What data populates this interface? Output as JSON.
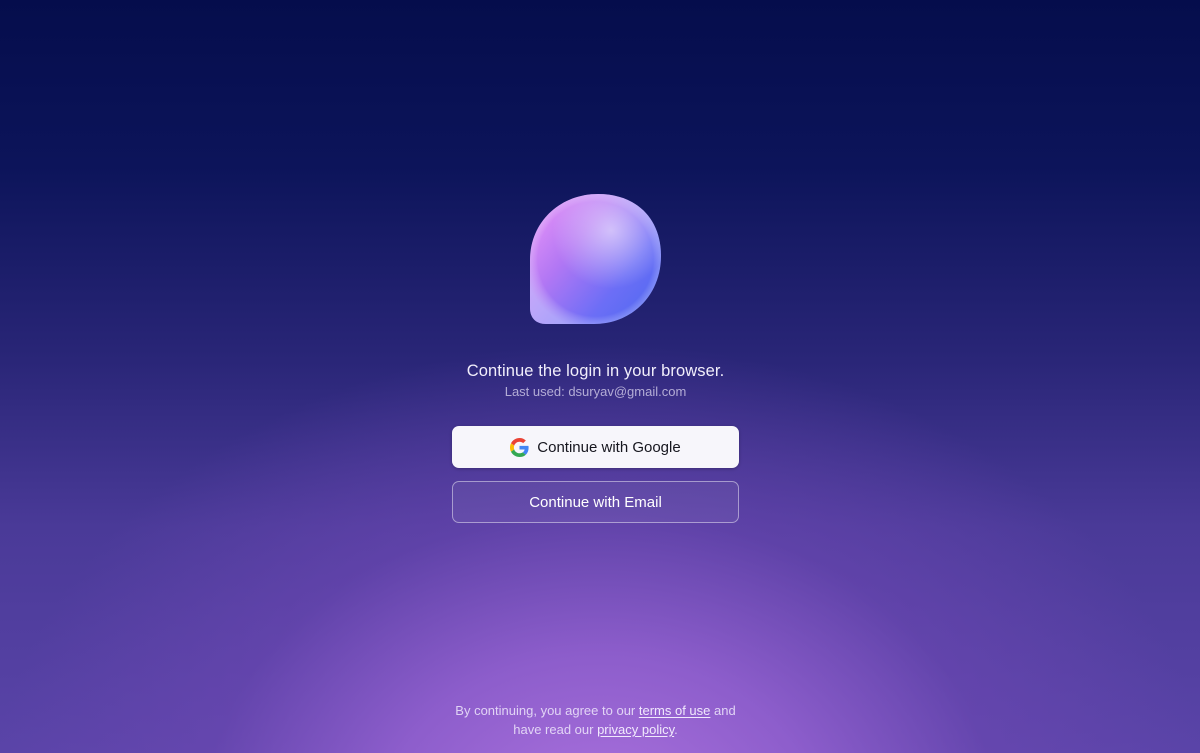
{
  "login": {
    "heading": "Continue the login in your browser.",
    "last_used": "Last used: dsuryav@gmail.com",
    "google_button_label": "Continue with Google",
    "email_button_label": "Continue with Email",
    "google_icon": "google-g-icon",
    "logo_icon": "speech-bubble-logo"
  },
  "legal": {
    "line1_prefix": "By continuing, you agree to our ",
    "terms_link": "terms of use",
    "line1_suffix": " and",
    "line2_prefix": "have read our ",
    "privacy_link": "privacy policy",
    "line2_suffix": "."
  },
  "colors": {
    "background_top": "#050d4c",
    "background_glow": "#ac72de",
    "google_button_bg": "#f7f6fb",
    "logo_pink": "#e08cf5",
    "logo_blue": "#5a6cf7"
  }
}
